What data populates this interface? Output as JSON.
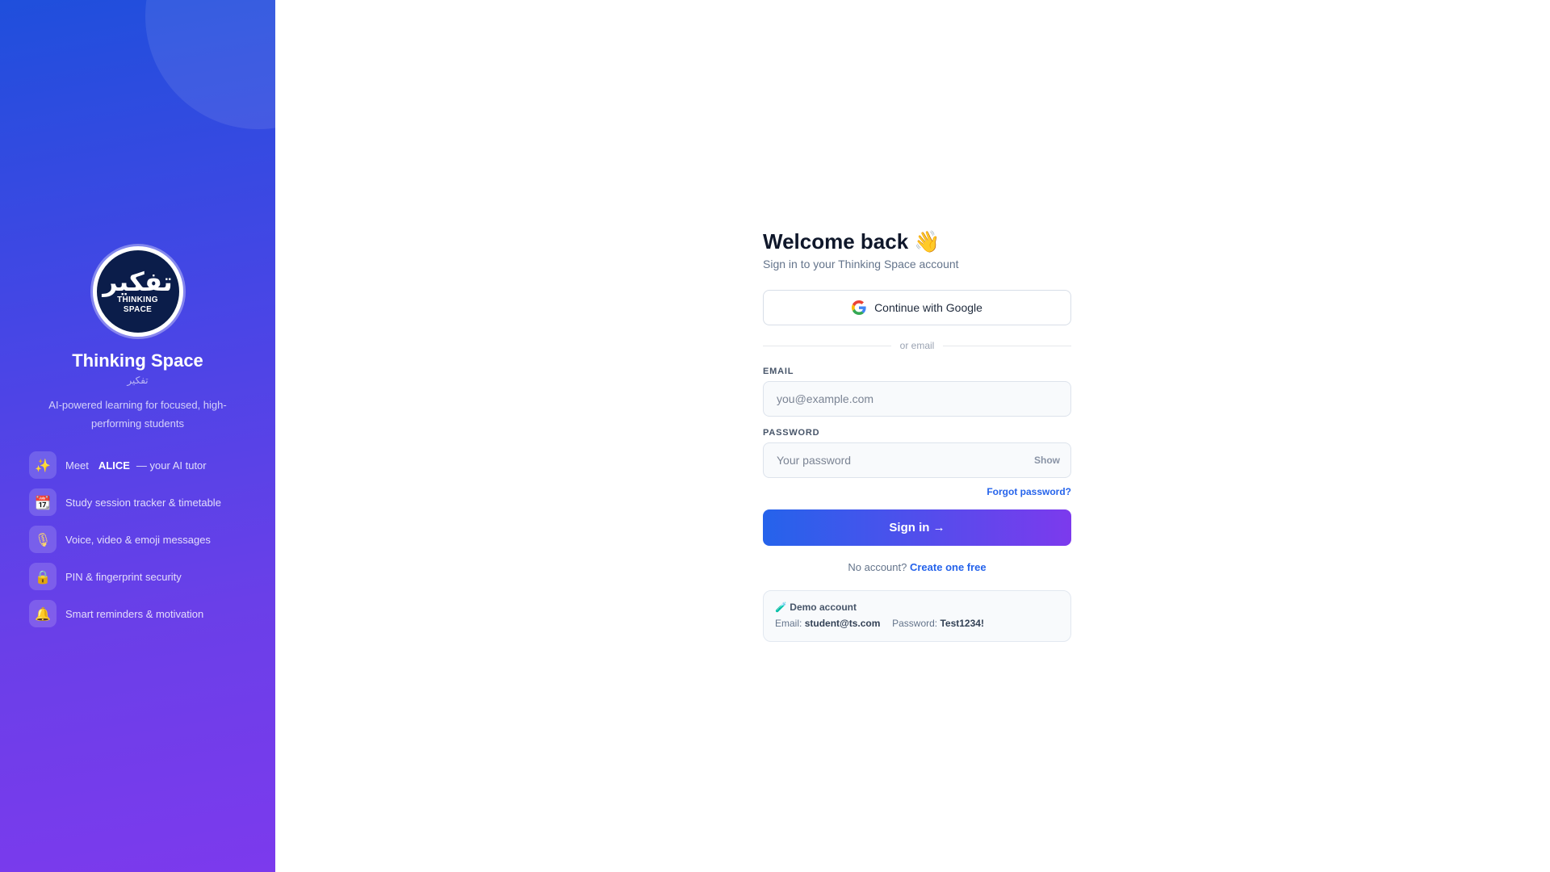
{
  "brand": {
    "logo_arabic": "تفكير",
    "logo_line1": "THINKING",
    "logo_line2": "SPACE",
    "name": "Thinking Space",
    "name_arabic": "تفكير",
    "tagline": "AI-powered learning for focused, high-performing students"
  },
  "features": [
    {
      "icon": "sparkles-icon",
      "glyph": "✨",
      "pre": "Meet",
      "bold": "ALICE",
      "post": "— your AI tutor"
    },
    {
      "icon": "calendar-icon",
      "glyph": "📆",
      "text": "Study session tracker & timetable"
    },
    {
      "icon": "microphone-icon",
      "glyph": "🎙",
      "text": "Voice, video & emoji messages"
    },
    {
      "icon": "lock-icon",
      "glyph": "🔒",
      "text": "PIN & fingerprint security"
    },
    {
      "icon": "bell-icon",
      "glyph": "🔔",
      "text": "Smart reminders & motivation"
    }
  ],
  "form": {
    "title": "Welcome back 👋",
    "subtitle": "Sign in to your Thinking Space account",
    "google_label": "Continue with Google",
    "divider": "or email",
    "email_label": "EMAIL",
    "email_placeholder": "you@example.com",
    "email_value": "",
    "password_label": "PASSWORD",
    "password_placeholder": "Your password",
    "password_value": "",
    "show_label": "Show",
    "forgot": "Forgot password?",
    "signin": "Sign in →",
    "no_account": "No account?",
    "create": "Create one free"
  },
  "demo": {
    "icon": "test-tube-icon",
    "glyph": "🧪",
    "title": "Demo account",
    "email_label": "Email:",
    "email": "student@ts.com",
    "password_label": "Password:",
    "password": "Test1234!"
  },
  "colors": {
    "accent": "#2563eb",
    "accent_purple": "#7c3aed",
    "panel_top": "#1f4fdc",
    "panel_bottom": "#7c3aed",
    "logo_bg": "#0b1d4a",
    "title": "#0f172a"
  }
}
